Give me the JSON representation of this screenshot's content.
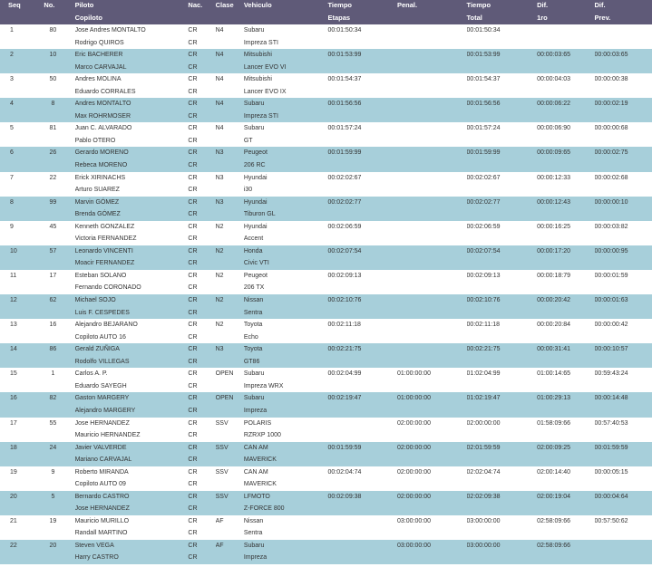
{
  "header": {
    "seq": "Seq",
    "no": "No.",
    "piloto": "Piloto",
    "copiloto": "Copiloto",
    "nac": "Nac.",
    "clase": "Clase",
    "vehiculo": "Vehiculo",
    "tiempo_etapas_1": "Tiempo",
    "tiempo_etapas_2": "Etapas",
    "penal": "Penal.",
    "tiempo_total_1": "Tiempo",
    "tiempo_total_2": "Total",
    "dif1_1": "Dif.",
    "dif1_2": "1ro",
    "difp_1": "Dif.",
    "difp_2": "Prev."
  },
  "colors": {
    "header_bg": "#5f5a78",
    "alt_row_bg": "#a7cfda"
  },
  "rows": [
    {
      "seq": "1",
      "no": "80",
      "piloto": "Jose Andres MONTALTO",
      "copiloto": "Rodrigo QUIROS",
      "nac1": "CR",
      "nac2": "CR",
      "clase": "N4",
      "veh1": "Subaru",
      "veh2": "Impreza STI",
      "etapas": "00:01:50:34",
      "penal": "",
      "total": "00:01:50:34",
      "dif1": "",
      "difp": ""
    },
    {
      "seq": "2",
      "no": "10",
      "piloto": "Eric BACHERER",
      "copiloto": "Marco CARVAJAL",
      "nac1": "CR",
      "nac2": "CR",
      "clase": "N4",
      "veh1": "Mitsubishi",
      "veh2": "Lancer EVO VI",
      "etapas": "00:01:53:99",
      "penal": "",
      "total": "00:01:53:99",
      "dif1": "00:00:03:65",
      "difp": "00:00:03:65"
    },
    {
      "seq": "3",
      "no": "50",
      "piloto": "Andres MOLINA",
      "copiloto": "Eduardo CORRALES",
      "nac1": "CR",
      "nac2": "CR",
      "clase": "N4",
      "veh1": "Mitsubishi",
      "veh2": "Lancer EVO IX",
      "etapas": "00:01:54:37",
      "penal": "",
      "total": "00:01:54:37",
      "dif1": "00:00:04:03",
      "difp": "00:00:00:38"
    },
    {
      "seq": "4",
      "no": "8",
      "piloto": "Andres MONTALTO",
      "copiloto": "Max ROHRMOSER",
      "nac1": "CR",
      "nac2": "CR",
      "clase": "N4",
      "veh1": "Subaru",
      "veh2": "Impreza STI",
      "etapas": "00:01:56:56",
      "penal": "",
      "total": "00:01:56:56",
      "dif1": "00:00:06:22",
      "difp": "00:00:02:19"
    },
    {
      "seq": "5",
      "no": "81",
      "piloto": "Juan C. ALVARADO",
      "copiloto": "Pablo OTERO",
      "nac1": "CR",
      "nac2": "CR",
      "clase": "N4",
      "veh1": "Subaru",
      "veh2": "GT",
      "etapas": "00:01:57:24",
      "penal": "",
      "total": "00:01:57:24",
      "dif1": "00:00:06:90",
      "difp": "00:00:00:68"
    },
    {
      "seq": "6",
      "no": "26",
      "piloto": "Gerardo MORENO",
      "copiloto": "Rebeca MORENO",
      "nac1": "CR",
      "nac2": "CR",
      "clase": "N3",
      "veh1": "Peugeot",
      "veh2": "206 RC",
      "etapas": "00:01:59:99",
      "penal": "",
      "total": "00:01:59:99",
      "dif1": "00:00:09:65",
      "difp": "00:00:02:75"
    },
    {
      "seq": "7",
      "no": "22",
      "piloto": "Erick XIRINACHS",
      "copiloto": "Arturo SUAREZ",
      "nac1": "CR",
      "nac2": "CR",
      "clase": "N3",
      "veh1": "Hyundai",
      "veh2": "i30",
      "etapas": "00:02:02:67",
      "penal": "",
      "total": "00:02:02:67",
      "dif1": "00:00:12:33",
      "difp": "00:00:02:68"
    },
    {
      "seq": "8",
      "no": "99",
      "piloto": "Marvin GÓMEZ",
      "copiloto": "Brenda GÓMEZ",
      "nac1": "CR",
      "nac2": "CR",
      "clase": "N3",
      "veh1": "Hyundai",
      "veh2": "Tiburon GL",
      "etapas": "00:02:02:77",
      "penal": "",
      "total": "00:02:02:77",
      "dif1": "00:00:12:43",
      "difp": "00:00:00:10"
    },
    {
      "seq": "9",
      "no": "45",
      "piloto": "Kenneth GONZALEZ",
      "copiloto": "Victoria FERNANDEZ",
      "nac1": "CR",
      "nac2": "CR",
      "clase": "N2",
      "veh1": "Hyundai",
      "veh2": "Accent",
      "etapas": "00:02:06:59",
      "penal": "",
      "total": "00:02:06:59",
      "dif1": "00:00:16:25",
      "difp": "00:00:03:82"
    },
    {
      "seq": "10",
      "no": "57",
      "piloto": "Leonardo VINCENTI",
      "copiloto": "Moacir FERNANDEZ",
      "nac1": "CR",
      "nac2": "CR",
      "clase": "N2",
      "veh1": "Honda",
      "veh2": "Civic VTI",
      "etapas": "00:02:07:54",
      "penal": "",
      "total": "00:02:07:54",
      "dif1": "00:00:17:20",
      "difp": "00:00:00:95"
    },
    {
      "seq": "11",
      "no": "17",
      "piloto": "Esteban SOLANO",
      "copiloto": "Fernando CORONADO",
      "nac1": "CR",
      "nac2": "CR",
      "clase": "N2",
      "veh1": "Peugeot",
      "veh2": "206 TX",
      "etapas": "00:02:09:13",
      "penal": "",
      "total": "00:02:09:13",
      "dif1": "00:00:18:79",
      "difp": "00:00:01:59"
    },
    {
      "seq": "12",
      "no": "62",
      "piloto": "Michael SOJO",
      "copiloto": "Luis F. CESPEDES",
      "nac1": "CR",
      "nac2": "CR",
      "clase": "N2",
      "veh1": "Nissan",
      "veh2": "Sentra",
      "etapas": "00:02:10:76",
      "penal": "",
      "total": "00:02:10:76",
      "dif1": "00:00:20:42",
      "difp": "00:00:01:63"
    },
    {
      "seq": "13",
      "no": "16",
      "piloto": "Alejandro BEJARANO",
      "copiloto": "Copiloto AUTO 16",
      "nac1": "CR",
      "nac2": "CR",
      "clase": "N2",
      "veh1": "Toyota",
      "veh2": "Echo",
      "etapas": "00:02:11:18",
      "penal": "",
      "total": "00:02:11:18",
      "dif1": "00:00:20:84",
      "difp": "00:00:00:42"
    },
    {
      "seq": "14",
      "no": "86",
      "piloto": "Gerald ZUÑIGA",
      "copiloto": "Rodolfo VILLEGAS",
      "nac1": "CR",
      "nac2": "CR",
      "clase": "N3",
      "veh1": "Toyota",
      "veh2": "GT86",
      "etapas": "00:02:21:75",
      "penal": "",
      "total": "00:02:21:75",
      "dif1": "00:00:31:41",
      "difp": "00:00:10:57"
    },
    {
      "seq": "15",
      "no": "1",
      "piloto": "Carlos A. P.",
      "copiloto": "Eduardo SAYEGH",
      "nac1": "CR",
      "nac2": "CR",
      "clase": "OPEN",
      "veh1": "Subaru",
      "veh2": "Impreza WRX",
      "etapas": "00:02:04:99",
      "penal": "01:00:00:00",
      "total": "01:02:04:99",
      "dif1": "01:00:14:65",
      "difp": "00:59:43:24"
    },
    {
      "seq": "16",
      "no": "82",
      "piloto": "Gaston MARGERY",
      "copiloto": "Alejandro MARGERY",
      "nac1": "CR",
      "nac2": "CR",
      "clase": "OPEN",
      "veh1": "Subaru",
      "veh2": "Impreza",
      "etapas": "00:02:19:47",
      "penal": "01:00:00:00",
      "total": "01:02:19:47",
      "dif1": "01:00:29:13",
      "difp": "00:00:14:48"
    },
    {
      "seq": "17",
      "no": "55",
      "piloto": "Jose HERNANDEZ",
      "copiloto": "Mauricio HERNANDEZ",
      "nac1": "CR",
      "nac2": "CR",
      "clase": "SSV",
      "veh1": "POLARIS",
      "veh2": "RZRXP 1000",
      "etapas": "",
      "penal": "02:00:00:00",
      "total": "02:00:00:00",
      "dif1": "01:58:09:66",
      "difp": "00:57:40:53"
    },
    {
      "seq": "18",
      "no": "24",
      "piloto": "Javier VALVERDE",
      "copiloto": "Mariano CARVAJAL",
      "nac1": "CR",
      "nac2": "CR",
      "clase": "SSV",
      "veh1": "CAN AM",
      "veh2": "MAVERICK",
      "etapas": "00:01:59:59",
      "penal": "02:00:00:00",
      "total": "02:01:59:59",
      "dif1": "02:00:09:25",
      "difp": "00:01:59:59"
    },
    {
      "seq": "19",
      "no": "9",
      "piloto": "Roberto MIRANDA",
      "copiloto": "Copiloto AUTO 09",
      "nac1": "CR",
      "nac2": "CR",
      "clase": "SSV",
      "veh1": "CAN AM",
      "veh2": "MAVERICK",
      "etapas": "00:02:04:74",
      "penal": "02:00:00:00",
      "total": "02:02:04:74",
      "dif1": "02:00:14:40",
      "difp": "00:00:05:15"
    },
    {
      "seq": "20",
      "no": "5",
      "piloto": "Bernardo CASTRO",
      "copiloto": "Jose HERNANDEZ",
      "nac1": "CR",
      "nac2": "CR",
      "clase": "SSV",
      "veh1": "LFMOTO",
      "veh2": "Z-FORCE 800",
      "etapas": "00:02:09:38",
      "penal": "02:00:00:00",
      "total": "02:02:09:38",
      "dif1": "02:00:19:04",
      "difp": "00:00:04:64"
    },
    {
      "seq": "21",
      "no": "19",
      "piloto": "Mauricio MURILLO",
      "copiloto": "Randall MARTINO",
      "nac1": "CR",
      "nac2": "CR",
      "clase": "AF",
      "veh1": "Nissan",
      "veh2": "Sentra",
      "etapas": "",
      "penal": "03:00:00:00",
      "total": "03:00:00:00",
      "dif1": "02:58:09:66",
      "difp": "00:57:50:62"
    },
    {
      "seq": "22",
      "no": "20",
      "piloto": "Steven VEGA",
      "copiloto": "Harry CASTRO",
      "nac1": "CR",
      "nac2": "CR",
      "clase": "AF",
      "veh1": "Subaru",
      "veh2": "Impreza",
      "etapas": "",
      "penal": "03:00:00:00",
      "total": "03:00:00:00",
      "dif1": "02:58:09:66",
      "difp": ""
    }
  ]
}
